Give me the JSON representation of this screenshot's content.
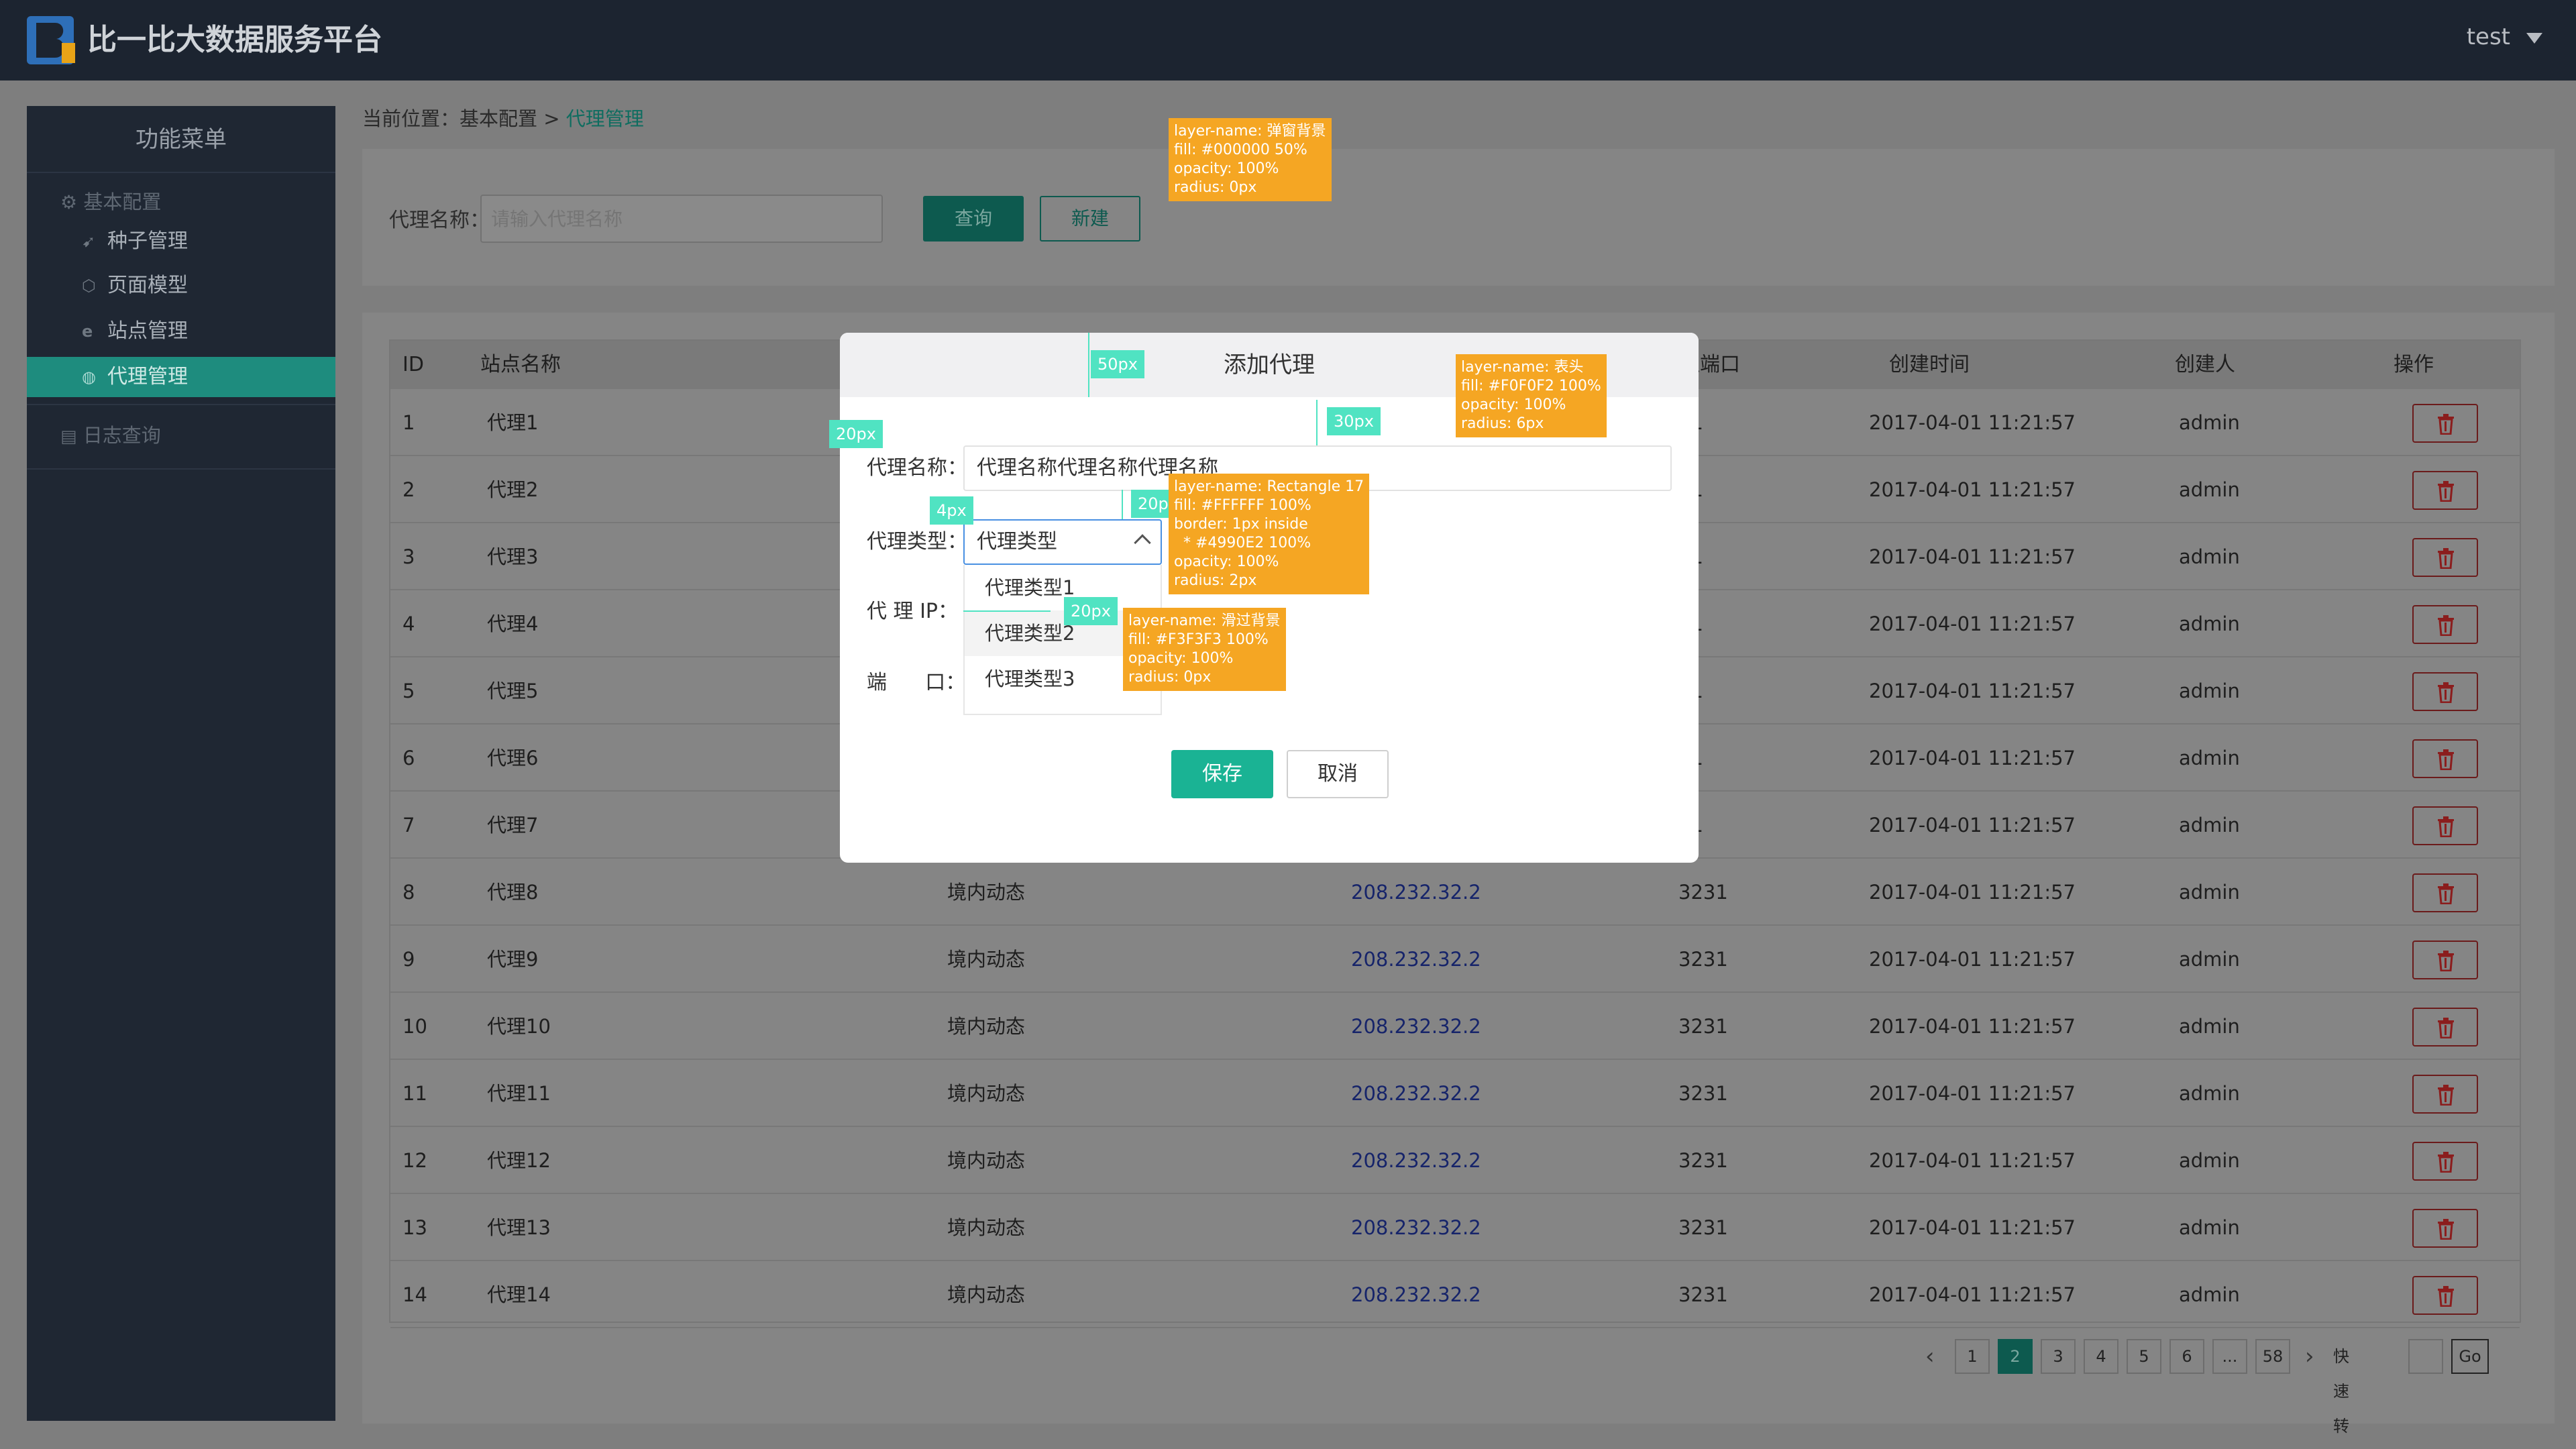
{
  "header": {
    "app_title": "比一比大数据服务平台",
    "user": "test",
    "logo_letter": "B"
  },
  "sidebar": {
    "title": "功能菜单",
    "group1": "基本配置",
    "items": [
      {
        "label": "种子管理",
        "icon": "leaf-icon"
      },
      {
        "label": "页面模型",
        "icon": "cube-icon"
      },
      {
        "label": "站点管理",
        "icon": "globe-e-icon"
      },
      {
        "label": "代理管理",
        "icon": "globe-icon"
      }
    ],
    "group2": "日志查询"
  },
  "breadcrumb": {
    "prefix": "当前位置：基本配置 > ",
    "current": "代理管理"
  },
  "filter": {
    "label": "代理名称：",
    "placeholder": "请输入代理名称",
    "query_button": "查询",
    "new_button": "新建"
  },
  "table": {
    "headers": {
      "id": "ID",
      "site": "站点名称",
      "port": "理端口",
      "created": "创建时间",
      "creator": "创建人",
      "op": "操作"
    },
    "rows": [
      {
        "id": "1",
        "name": "代理1",
        "type": "",
        "ip": "",
        "port": "31",
        "time": "2017-04-01 11:21:57",
        "creator": "admin"
      },
      {
        "id": "2",
        "name": "代理2",
        "type": "",
        "ip": "",
        "port": "31",
        "time": "2017-04-01 11:21:57",
        "creator": "admin"
      },
      {
        "id": "3",
        "name": "代理3",
        "type": "",
        "ip": "",
        "port": "31",
        "time": "2017-04-01 11:21:57",
        "creator": "admin"
      },
      {
        "id": "4",
        "name": "代理4",
        "type": "",
        "ip": "",
        "port": "31",
        "time": "2017-04-01 11:21:57",
        "creator": "admin"
      },
      {
        "id": "5",
        "name": "代理5",
        "type": "",
        "ip": "",
        "port": "31",
        "time": "2017-04-01 11:21:57",
        "creator": "admin"
      },
      {
        "id": "6",
        "name": "代理6",
        "type": "",
        "ip": "",
        "port": "31",
        "time": "2017-04-01 11:21:57",
        "creator": "admin"
      },
      {
        "id": "7",
        "name": "代理7",
        "type": "",
        "ip": "",
        "port": "31",
        "time": "2017-04-01 11:21:57",
        "creator": "admin"
      },
      {
        "id": "8",
        "name": "代理8",
        "type": "境内动态",
        "ip": "208.232.32.2",
        "port": "3231",
        "time": "2017-04-01 11:21:57",
        "creator": "admin"
      },
      {
        "id": "9",
        "name": "代理9",
        "type": "境内动态",
        "ip": "208.232.32.2",
        "port": "3231",
        "time": "2017-04-01 11:21:57",
        "creator": "admin"
      },
      {
        "id": "10",
        "name": "代理10",
        "type": "境内动态",
        "ip": "208.232.32.2",
        "port": "3231",
        "time": "2017-04-01 11:21:57",
        "creator": "admin"
      },
      {
        "id": "11",
        "name": "代理11",
        "type": "境内动态",
        "ip": "208.232.32.2",
        "port": "3231",
        "time": "2017-04-01 11:21:57",
        "creator": "admin"
      },
      {
        "id": "12",
        "name": "代理12",
        "type": "境内动态",
        "ip": "208.232.32.2",
        "port": "3231",
        "time": "2017-04-01 11:21:57",
        "creator": "admin"
      },
      {
        "id": "13",
        "name": "代理13",
        "type": "境内动态",
        "ip": "208.232.32.2",
        "port": "3231",
        "time": "2017-04-01 11:21:57",
        "creator": "admin"
      },
      {
        "id": "14",
        "name": "代理14",
        "type": "境内动态",
        "ip": "208.232.32.2",
        "port": "3231",
        "time": "2017-04-01 11:21:57",
        "creator": "admin"
      }
    ]
  },
  "pagination": {
    "pages": [
      "1",
      "2",
      "3",
      "4",
      "5",
      "6",
      "...",
      "58"
    ],
    "active": "2",
    "jump_label": "快速转到",
    "go": "Go"
  },
  "modal": {
    "title": "添加代理",
    "name_label": "代理名称：",
    "name_value": "代理名称代理名称代理名称",
    "type_label": "代理类型：",
    "type_value": "代理类型",
    "type_options": [
      "代理类型1",
      "代理类型2",
      "代理类型3"
    ],
    "ip_label": "代 理  IP：",
    "port_label": "端      口：",
    "save": "保存",
    "cancel": "取消"
  },
  "annotations": {
    "overlay_note": "layer-name: 弹窗背景\nfill: #000000 50%\nopacity: 100%\nradius: 0px",
    "header_note": "layer-name: 表头\nfill: #F0F0F2 100%\nopacity: 100%\nradius: 6px",
    "select_note": "layer-name: Rectangle 17\nfill: #FFFFFF 100%\nborder: 1px inside\n  * #4990E2 100%\nopacity: 100%\nradius: 2px",
    "hover_note": "layer-name: 滑过背景\nfill: #F3F3F3 100%\nopacity: 100%\nradius: 0px",
    "m_50": "50px",
    "m_30": "30px",
    "m_20a": "20px",
    "m_20b": "20px",
    "m_20c": "20px",
    "m_4": "4px"
  },
  "colors": {
    "accent": "#1ab394",
    "select_border": "#4990e2",
    "note_bg": "#f5a623",
    "measure": "#50e3c2",
    "topbar": "#1c2430"
  }
}
